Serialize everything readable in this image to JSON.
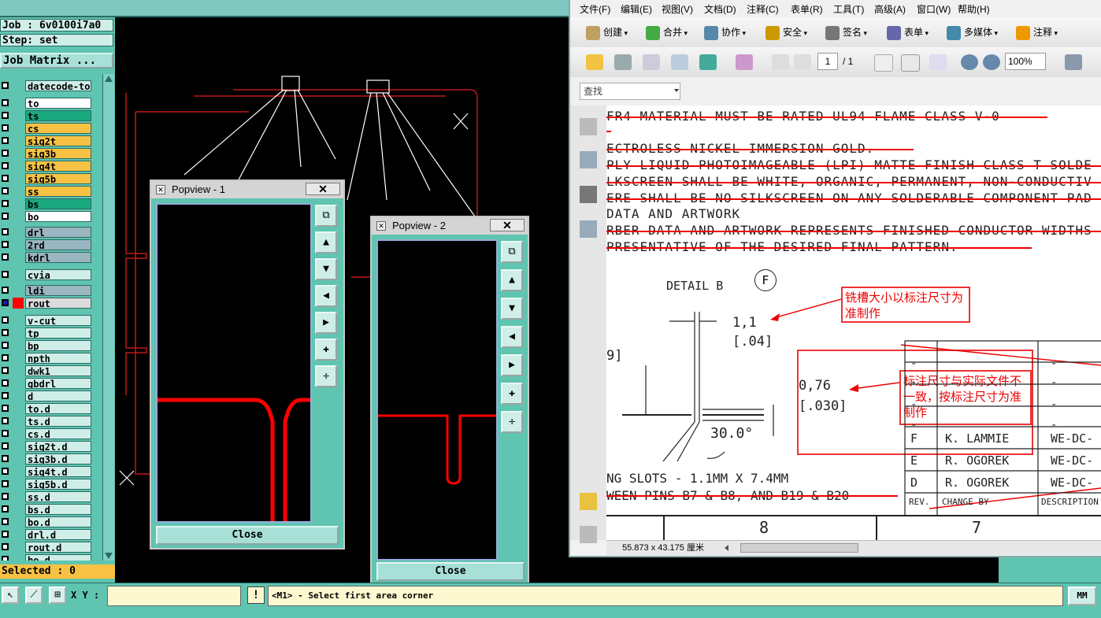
{
  "cam": {
    "job_line": "Job : 6v0100i7a0",
    "step_line": "Step: set",
    "job_matrix": "Job Matrix ...",
    "layers": [
      {
        "name": "datecode-to",
        "color": "#cfeee8"
      },
      {
        "name": "to",
        "color": "#ffffff"
      },
      {
        "name": "ts",
        "color": "#1aa97f"
      },
      {
        "name": "cs",
        "color": "#f7c244"
      },
      {
        "name": "sig2t",
        "color": "#f7c244"
      },
      {
        "name": "sig3b",
        "color": "#f7c244"
      },
      {
        "name": "sig4t",
        "color": "#f7c244"
      },
      {
        "name": "sig5b",
        "color": "#f7c244"
      },
      {
        "name": "ss",
        "color": "#f7c244"
      },
      {
        "name": "bs",
        "color": "#1aa97f"
      },
      {
        "name": "bo",
        "color": "#ffffff"
      },
      {
        "name": "drl",
        "color": "#9ab6c0"
      },
      {
        "name": "2rd",
        "color": "#9ab6c0"
      },
      {
        "name": "kdrl",
        "color": "#9ab6c0"
      },
      {
        "name": "cvia",
        "color": "#cfeee8"
      },
      {
        "name": "ldi",
        "color": "#9ab6c0"
      },
      {
        "name": "rout",
        "color": "#dcdcdc"
      },
      {
        "name": "v-cut",
        "color": "#cfeee8"
      },
      {
        "name": "tp",
        "color": "#cfeee8"
      },
      {
        "name": "bp",
        "color": "#cfeee8"
      },
      {
        "name": "npth",
        "color": "#cfeee8"
      },
      {
        "name": "dwk1",
        "color": "#cfeee8"
      },
      {
        "name": "gbdrl",
        "color": "#cfeee8"
      },
      {
        "name": "d",
        "color": "#cfeee8"
      },
      {
        "name": "to.d",
        "color": "#cfeee8"
      },
      {
        "name": "ts.d",
        "color": "#cfeee8"
      },
      {
        "name": "cs.d",
        "color": "#cfeee8"
      },
      {
        "name": "sig2t.d",
        "color": "#cfeee8"
      },
      {
        "name": "sig3b.d",
        "color": "#cfeee8"
      },
      {
        "name": "sig4t.d",
        "color": "#cfeee8"
      },
      {
        "name": "sig5b.d",
        "color": "#cfeee8"
      },
      {
        "name": "ss.d",
        "color": "#cfeee8"
      },
      {
        "name": "bs.d",
        "color": "#cfeee8"
      },
      {
        "name": "bo.d",
        "color": "#cfeee8"
      },
      {
        "name": "drl.d",
        "color": "#cfeee8"
      },
      {
        "name": "rout.d",
        "color": "#cfeee8"
      },
      {
        "name": "bo.d",
        "color": "#cfeee8"
      }
    ],
    "selected": "Selected : 0",
    "xy_label": "X Y :",
    "prompt": "<M1> - Select first area corner",
    "units": "MM"
  },
  "popview1": {
    "title": "Popview - 1",
    "close_x": "✕",
    "close": "Close"
  },
  "popview2": {
    "title": "Popview - 2",
    "close_x": "✕",
    "close": "Close"
  },
  "pdf": {
    "menus": [
      "文件(F)",
      "编辑(E)",
      "视图(V)",
      "文档(D)",
      "注释(C)",
      "表单(R)",
      "工具(T)",
      "高级(A)",
      "窗口(W)",
      "帮助(H)"
    ],
    "tasks": [
      "创建",
      "合并",
      "协作",
      "安全",
      "签名",
      "表单",
      "多媒体",
      "注释"
    ],
    "page_current": "1",
    "page_total": "/ 1",
    "zoom": "100%",
    "search_placeholder": "查找",
    "notes": [
      "FR4 MATERIAL MUST BE RATED UL94 FLAME CLASS V-0",
      "ECTROLESS NICKEL IMMERSION GOLD.",
      "PLY LIQUID PHOTOIMAGEABLE (LPI) MATTE FINISH CLASS T SOLDE",
      "LKSCREEN SHALL BE WHITE, ORGANIC, PERMANENT, NON-CONDUCTIV",
      "ERE SHALL BE NO SILKSCREEN ON ANY SOLDERABLE COMPONENT PAD",
      "DATA AND ARTWORK",
      "RBER DATA AND ARTWORK REPRESENTS FINISHED CONDUCTOR WIDTHS",
      "PRESENTATIVE OF THE DESIRED FINAL PATTERN."
    ],
    "detail_label": "DETAIL B",
    "detail_circle": "F",
    "dim_1": "1,1",
    "dim_1_in": "[.04]",
    "dim_2": "0,76",
    "dim_2_in": "[.030]",
    "dim_9": "9]",
    "angle": "30.0°",
    "callout_1": "铣槽大小以标注尺寸为准制作",
    "callout_2": "标注尺寸与实际文件不一致，按标注尺寸为准制作",
    "slots_line": "NG SLOTS - 1.1MM X 7.4MM",
    "pins_line": "WEEN PINS B7 & B8, AND B19 & B20",
    "rev_rows": [
      {
        "rev": "F",
        "by": "K. LAMMIE",
        "desc": "WE-DC-"
      },
      {
        "rev": "E",
        "by": "R. OGOREK",
        "desc": "WE-DC-"
      },
      {
        "rev": "D",
        "by": "R. OGOREK",
        "desc": "WE-DC-"
      }
    ],
    "rev_header": [
      "REV.",
      "CHANGE BY",
      "DESCRIPTION"
    ],
    "grid_8": "8",
    "grid_7": "7",
    "status_size": "55.873 x 43.175 厘米"
  }
}
